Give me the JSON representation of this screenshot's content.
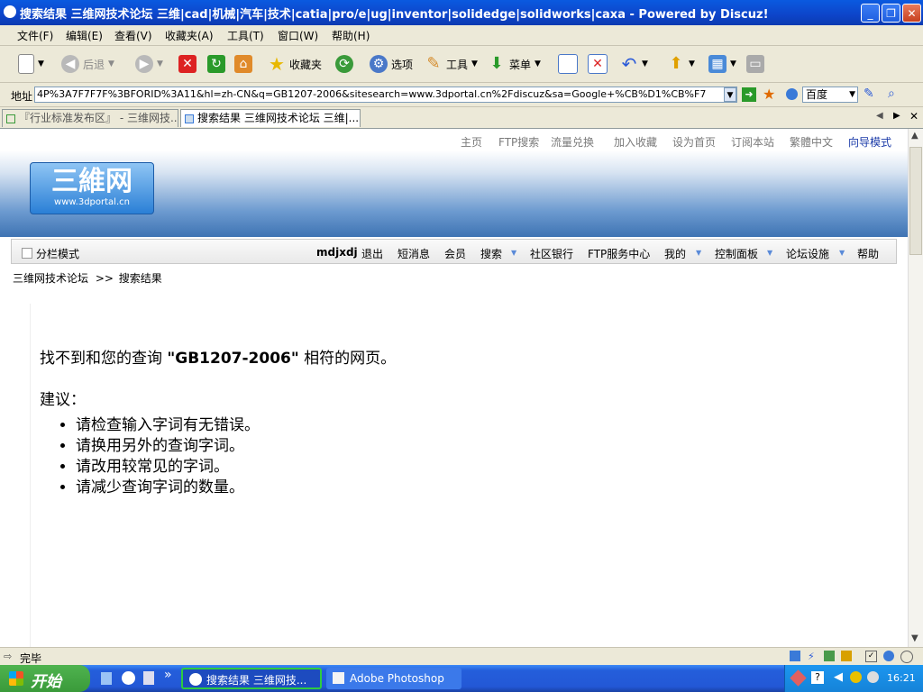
{
  "window": {
    "title": "搜索结果 三维网技术论坛 三维|cad|机械|汽车|技术|catia|pro/e|ug|inventor|solidedge|solidworks|caxa - Powered by Discuz!"
  },
  "menubar": [
    "文件(F)",
    "编辑(E)",
    "查看(V)",
    "收藏夹(A)",
    "工具(T)",
    "窗口(W)",
    "帮助(H)"
  ],
  "toolbar": {
    "back": "后退",
    "favorites": "收藏夹",
    "options": "选项",
    "tools": "工具",
    "menu": "菜单"
  },
  "address": {
    "label": "地址",
    "url": "4P%3A7F7F7F%3BFORID%3A11&hl=zh-CN&q=GB1207-2006&sitesearch=www.3dportal.cn%2Fdiscuz&sa=Google+%CB%D1%CB%F7",
    "search_engine": "百度"
  },
  "tabs": [
    {
      "label": "『行业标准发布区』 - 三维网技..."
    },
    {
      "label": "搜索结果 三维网技术论坛 三维|..."
    }
  ],
  "site": {
    "toplinks": [
      "主页",
      "FTP搜索",
      "流量兑换",
      "加入收藏",
      "设为首页",
      "订阅本站",
      "繁體中文",
      "向导模式"
    ],
    "logo": {
      "title": "三維网",
      "url": "www.3dportal.cn"
    },
    "split_mode": "分栏模式",
    "nav": [
      "mdjxdj",
      "退出",
      "短消息",
      "会员",
      "搜索",
      "社区银行",
      "FTP服务中心",
      "我的",
      "控制面板",
      "论坛设施",
      "帮助"
    ],
    "breadcrumb": [
      "三维网技术论坛",
      ">>",
      "搜索结果"
    ]
  },
  "result": {
    "msg_before": "找不到和您的查询 ",
    "query": "\"GB1207-2006\"",
    "msg_after": " 相符的网页。",
    "suggest_label": "建议：",
    "suggestions": [
      "请检查输入字词有无错误。",
      "请换用另外的查询字词。",
      "请改用较常见的字词。",
      "请减少查询字词的数量。"
    ]
  },
  "status": {
    "text": "完毕"
  },
  "taskbar": {
    "start": "开始",
    "tasks": [
      "搜索结果 三维网技...",
      "Adobe Photoshop"
    ],
    "clock": "16:21"
  }
}
